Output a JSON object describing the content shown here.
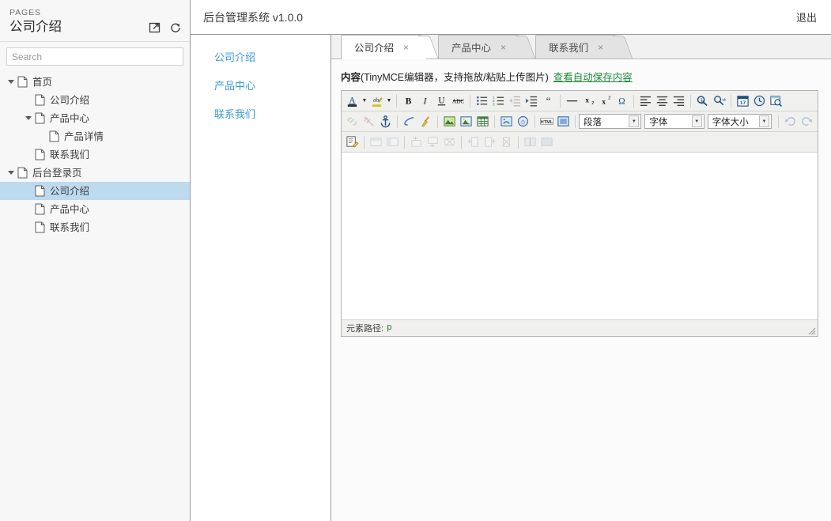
{
  "sidebar": {
    "kicker": "PAGES",
    "title": "公司介绍",
    "icons": [
      {
        "name": "open-external-icon"
      },
      {
        "name": "refresh-icon"
      }
    ],
    "search": {
      "placeholder": "Search",
      "value": ""
    },
    "tree": [
      {
        "label": "首页",
        "depth": 0,
        "expandable": true,
        "expanded": true,
        "selected": false
      },
      {
        "label": "公司介绍",
        "depth": 1,
        "expandable": false,
        "expanded": false,
        "selected": false
      },
      {
        "label": "产品中心",
        "depth": 1,
        "expandable": true,
        "expanded": true,
        "selected": false
      },
      {
        "label": "产品详情",
        "depth": 2,
        "expandable": false,
        "expanded": false,
        "selected": false
      },
      {
        "label": "联系我们",
        "depth": 1,
        "expandable": false,
        "expanded": false,
        "selected": false
      },
      {
        "label": "后台登录页",
        "depth": 0,
        "expandable": true,
        "expanded": true,
        "selected": false
      },
      {
        "label": "公司介绍",
        "depth": 1,
        "expandable": false,
        "expanded": false,
        "selected": true
      },
      {
        "label": "产品中心",
        "depth": 1,
        "expandable": false,
        "expanded": false,
        "selected": false
      },
      {
        "label": "联系我们",
        "depth": 1,
        "expandable": false,
        "expanded": false,
        "selected": false
      }
    ]
  },
  "topbar": {
    "brand": "后台管理系统 v1.0.0",
    "logout": "退出"
  },
  "nav": {
    "links": [
      {
        "label": "公司介绍"
      },
      {
        "label": "产品中心"
      },
      {
        "label": "联系我们"
      }
    ]
  },
  "tabs": [
    {
      "label": "公司介绍",
      "close": "×",
      "active": true
    },
    {
      "label": "产品中心",
      "close": "×",
      "active": false
    },
    {
      "label": "联系我们",
      "close": "×",
      "active": false
    }
  ],
  "editor": {
    "label_strong": "内容",
    "label_rest": "(TinyMCE编辑器，支持拖放/粘贴上传图片)",
    "autosave_link": "查看自动保存内容",
    "content": "",
    "status_label": "元素路径:",
    "status_path": "p",
    "selects": {
      "paragraph": "段落",
      "font": "字体",
      "fontsize": "字体大小"
    },
    "toolbar_row1": [
      {
        "name": "text-color-button",
        "glyph": "A",
        "kind": "color-a",
        "dim": false
      },
      {
        "name": "text-color-dropdown",
        "glyph": "▼",
        "kind": "arrow",
        "dim": false
      },
      {
        "name": "background-color-button",
        "glyph": "ab",
        "kind": "color-ab",
        "dim": false
      },
      {
        "name": "background-color-dropdown",
        "glyph": "▼",
        "kind": "arrow",
        "dim": false
      },
      {
        "name": "separator",
        "kind": "sep"
      },
      {
        "name": "bold-button",
        "glyph": "B",
        "kind": "bold",
        "dim": false
      },
      {
        "name": "italic-button",
        "glyph": "I",
        "kind": "italic",
        "dim": false
      },
      {
        "name": "underline-button",
        "glyph": "U",
        "kind": "underline",
        "dim": false
      },
      {
        "name": "strikethrough-button",
        "glyph": "ABC",
        "kind": "strike",
        "dim": false
      },
      {
        "name": "separator",
        "kind": "sep"
      },
      {
        "name": "bullet-list-button",
        "glyph": "☰",
        "kind": "ul",
        "dim": false
      },
      {
        "name": "numbered-list-button",
        "glyph": "☰",
        "kind": "ol",
        "dim": false
      },
      {
        "name": "outdent-button",
        "glyph": "⇤",
        "kind": "outdent",
        "dim": true
      },
      {
        "name": "indent-button",
        "glyph": "⇥",
        "kind": "indent",
        "dim": false
      },
      {
        "name": "blockquote-button",
        "glyph": "❝",
        "kind": "quote",
        "dim": false
      },
      {
        "name": "separator",
        "kind": "sep"
      },
      {
        "name": "horizontal-rule-button",
        "glyph": "—",
        "kind": "hr",
        "dim": false
      },
      {
        "name": "subscript-button",
        "glyph": "x₂",
        "kind": "sub",
        "dim": false
      },
      {
        "name": "superscript-button",
        "glyph": "x²",
        "kind": "sup",
        "dim": false
      },
      {
        "name": "special-character-button",
        "glyph": "Ω",
        "kind": "omega",
        "dim": false
      },
      {
        "name": "separator",
        "kind": "sep"
      },
      {
        "name": "align-left-button",
        "glyph": "≡",
        "kind": "alignl",
        "dim": false
      },
      {
        "name": "align-center-button",
        "glyph": "≡",
        "kind": "alignc",
        "dim": false
      },
      {
        "name": "align-right-button",
        "glyph": "≡",
        "kind": "alignr",
        "dim": false
      },
      {
        "name": "separator",
        "kind": "sep"
      },
      {
        "name": "find-button",
        "glyph": "🔍",
        "kind": "find",
        "dim": false
      },
      {
        "name": "find-replace-button",
        "glyph": "🔍",
        "kind": "replace",
        "dim": false
      },
      {
        "name": "separator",
        "kind": "sep"
      },
      {
        "name": "insert-date-button",
        "glyph": "17",
        "kind": "date",
        "dim": false
      },
      {
        "name": "insert-time-button",
        "glyph": "🕐",
        "kind": "time",
        "dim": false
      },
      {
        "name": "preview-button",
        "glyph": "🔎",
        "kind": "preview",
        "dim": false
      }
    ],
    "toolbar_row2": [
      {
        "name": "insert-link-button",
        "kind": "link",
        "dim": true
      },
      {
        "name": "unlink-button",
        "kind": "unlink",
        "dim": true
      },
      {
        "name": "anchor-button",
        "kind": "anchor",
        "dim": false
      },
      {
        "name": "separator",
        "kind": "sep"
      },
      {
        "name": "cleanup-button",
        "kind": "cleanup",
        "dim": false
      },
      {
        "name": "remove-format-button",
        "kind": "broom",
        "dim": false
      },
      {
        "name": "separator",
        "kind": "sep"
      },
      {
        "name": "insert-image-button",
        "kind": "image",
        "dim": false
      },
      {
        "name": "insert-media-button",
        "kind": "media",
        "dim": false
      },
      {
        "name": "insert-table-button",
        "kind": "table",
        "dim": false
      },
      {
        "name": "separator",
        "kind": "sep"
      },
      {
        "name": "emotions-button",
        "kind": "emotion",
        "dim": false
      },
      {
        "name": "insert-embed-button",
        "kind": "embed",
        "dim": false
      },
      {
        "name": "separator",
        "kind": "sep"
      },
      {
        "name": "source-code-button",
        "kind": "html",
        "dim": false
      },
      {
        "name": "fullscreen-button",
        "kind": "screen",
        "dim": false
      },
      {
        "name": "separator",
        "kind": "sep"
      }
    ],
    "toolbar_row3": [
      {
        "name": "edit-css-button",
        "kind": "editcss",
        "dim": false
      },
      {
        "name": "separator",
        "kind": "sep"
      },
      {
        "name": "table-row-props-button",
        "kind": "rowprop",
        "dim": true
      },
      {
        "name": "table-cell-props-button",
        "kind": "cellprop",
        "dim": true
      },
      {
        "name": "separator",
        "kind": "sep"
      },
      {
        "name": "insert-row-before-button",
        "kind": "rowbefore",
        "dim": true
      },
      {
        "name": "insert-row-after-button",
        "kind": "rowafter",
        "dim": true
      },
      {
        "name": "delete-row-button",
        "kind": "delrow",
        "dim": true
      },
      {
        "name": "separator",
        "kind": "sep"
      },
      {
        "name": "insert-col-before-button",
        "kind": "colbefore",
        "dim": true
      },
      {
        "name": "insert-col-after-button",
        "kind": "colafter",
        "dim": true
      },
      {
        "name": "delete-col-button",
        "kind": "delcol",
        "dim": true
      },
      {
        "name": "separator",
        "kind": "sep"
      },
      {
        "name": "split-cells-button",
        "kind": "split",
        "dim": true
      },
      {
        "name": "merge-cells-button",
        "kind": "merge",
        "dim": true
      }
    ],
    "undo_label": "↶",
    "redo_label": "↷"
  },
  "colors": {
    "accent_link": "#3a9ad9",
    "autosave_link": "#1e8b3a",
    "selection": "#bedaee",
    "sidebar_bg": "#f7f7f7",
    "toolbar_bg": "#f0f0ee"
  }
}
